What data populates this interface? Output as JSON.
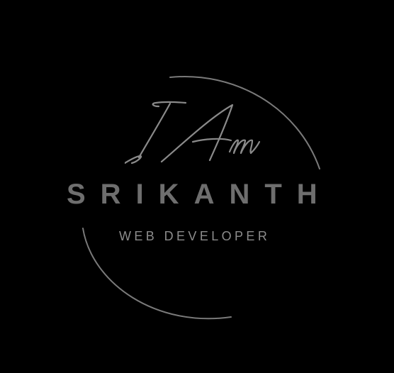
{
  "logo": {
    "script_line": "I Am",
    "name": "SRIKANTH",
    "role": "WEB DEVELOPER"
  },
  "colors": {
    "background": "#000000",
    "name_text": "#6e6e6e",
    "role_text": "#8c8c8c",
    "ring_stroke": "#7a7a7a",
    "script_stroke": "#8a8a8a"
  }
}
